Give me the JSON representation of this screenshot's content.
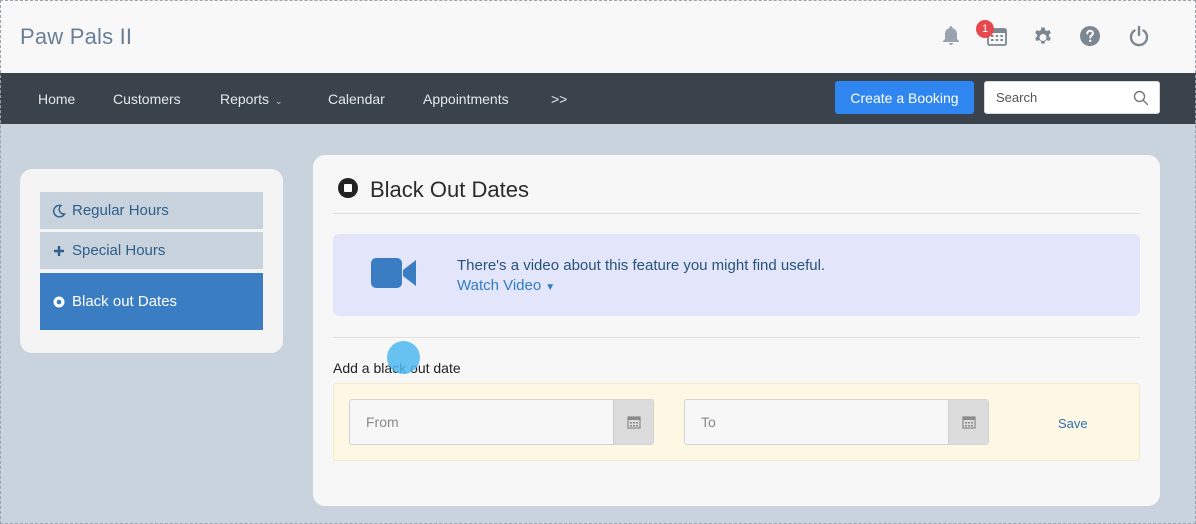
{
  "app": {
    "title": "Paw Pals II"
  },
  "header": {
    "notification_count": "1",
    "icons": [
      "bell-icon",
      "calendar-icon",
      "gear-icon",
      "help-icon",
      "power-icon"
    ]
  },
  "nav": {
    "items": [
      "Home",
      "Customers",
      "Reports",
      "Calendar",
      "Appointments",
      ">>"
    ],
    "create_label": "Create a Booking",
    "search_placeholder": "Search"
  },
  "sidebar": {
    "items": [
      {
        "label": "Regular Hours",
        "icon": "moon-icon"
      },
      {
        "label": "Special Hours",
        "icon": "plus-icon"
      },
      {
        "label": "Black out Dates",
        "icon": "circle-dot-icon",
        "active": true
      }
    ]
  },
  "main": {
    "title": "Black Out Dates",
    "video": {
      "text": "There's a video about this feature you might find useful.",
      "link": "Watch Video"
    },
    "add_label": "Add a black out date",
    "from_placeholder": "From",
    "to_placeholder": "To",
    "save_label": "Save"
  },
  "colors": {
    "nav_bg": "#3a424c",
    "accent": "#2f86f0",
    "active_side": "#3a7dc2",
    "page_bg": "#c8d3de"
  }
}
